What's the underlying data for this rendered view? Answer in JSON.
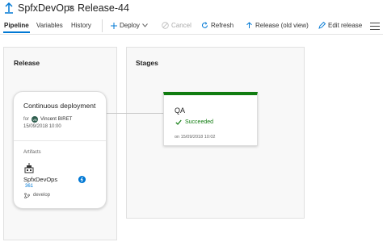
{
  "header": {
    "pipeline_name": "SpfxDevOps",
    "separator": ">",
    "release_name": "Release-44",
    "chevron": "⌄"
  },
  "tabs": [
    {
      "label": "Pipeline",
      "active": true
    },
    {
      "label": "Variables",
      "active": false
    },
    {
      "label": "History",
      "active": false
    }
  ],
  "toolbar": {
    "deploy": "Deploy",
    "cancel": "Cancel",
    "refresh": "Refresh",
    "release_old_view": "Release (old view)",
    "edit_release": "Edit release"
  },
  "release_panel": {
    "title": "Release",
    "card": {
      "title": "Continuous deployment",
      "for_label": "for",
      "avatar_initials": "VB",
      "user": "Vincent BIRET",
      "date": "15/09/2018 10:00",
      "artifacts_label": "Artifacts",
      "artifact_name": "SpfxDevOps",
      "build_number": "361",
      "branch": "develop"
    }
  },
  "stages_panel": {
    "title": "Stages",
    "stage": {
      "name": "QA",
      "status": "Succeeded",
      "date": "on 15/09/2018 10:02"
    }
  },
  "colors": {
    "accent": "#0078d4",
    "success": "#107c10"
  },
  "icons": [
    "pipeline-icon",
    "plus-icon",
    "chevron-down-icon",
    "cancel-icon",
    "refresh-icon",
    "release-icon",
    "edit-icon",
    "hamburger-icon",
    "avatar",
    "build-icon",
    "lightning-icon",
    "branch-icon",
    "check-icon"
  ]
}
